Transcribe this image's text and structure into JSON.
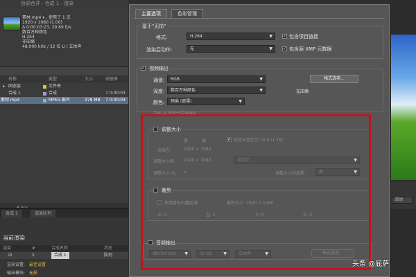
{
  "background": {
    "window_title": "协调合并 · 合成 1 · 渲染",
    "project_info": [
      "素材.mp4 ▾ , 使用了 1 次",
      "1920 x 1080 (1.00)",
      "Δ 0:00:03:23, 29.89 fps",
      "数百万种颜色",
      "H.264",
      "非压缩",
      "48.000 kHz / 32 位 U / 立体声"
    ],
    "columns": [
      "名称",
      "类型",
      "大小",
      "帧速率"
    ],
    "files": [
      {
        "name": "固态层",
        "type": "文件夹",
        "size": "",
        "fps": ""
      },
      {
        "name": "合成 1",
        "type": "合成",
        "size": "",
        "fps": "7 0:00:03"
      },
      {
        "name": "素材.mp4",
        "type": "MPEG 影片",
        "size": "378 MB",
        "fps": "7 0:00:03"
      }
    ],
    "status_bpc": "8 bpc",
    "queue_tabs": [
      "合成 1",
      "渲染队列"
    ],
    "queue_title": "当前渲染",
    "queue_columns": [
      "渲染",
      "#",
      "合成名称",
      "状态"
    ],
    "queue_row": {
      "num": "1",
      "name": "合成 1",
      "status": "队列"
    },
    "render_settings_label": "渲染设置:",
    "render_settings_value": "最佳设置",
    "output_module_label": "输出模块:",
    "output_module_value": "无损",
    "right_dropdown": "活动"
  },
  "dialog": {
    "tabs": [
      "主要选项",
      "色彩管理"
    ],
    "based_on": "基于\"无损\"",
    "format_label": "格式:",
    "format_value": "H.264",
    "post_render_label": "渲染后动作:",
    "post_render_value": "无",
    "include_project_link": "包含项目链接",
    "include_xmp": "包含源 XMP 元数据",
    "video_output": "视频输出",
    "channels_label": "通道:",
    "channels_value": "RGB",
    "depth_label": "深度:",
    "depth_value": "数百万种颜色",
    "color_label": "颜色:",
    "color_value": "预乘 (遮罩)",
    "format_options_btn": "格式选项...",
    "no_compression": "无压缩",
    "hidden_row": "开始 #  使用合成帧编号",
    "resize": {
      "title": "调整大小",
      "width_label": "宽",
      "height_label": "高",
      "lock_aspect": "锁定长宽比为 16:9 (1.78)",
      "render_at_label": "渲染在:",
      "render_at_value": "1920 × 1080",
      "resize_to_label": "调整大小到:",
      "resize_to_value": "1920 × 1080",
      "custom": "自定义",
      "percent_label": "调整大小 %:",
      "percent_value": "×",
      "quality_label": "调整大小后品质:",
      "quality_value": "高"
    },
    "crop": {
      "title": "裁剪",
      "use_roi": "使用目标兴趣区域",
      "final_size": "最终大小: 1920 × 1080",
      "top": "上: 0",
      "left": "左: 0",
      "bottom": "下: 0",
      "right": "右: 0"
    },
    "audio": {
      "title": "音频输出",
      "rate": "48.000 kHz",
      "bit": "32 bit",
      "channel": "立体声",
      "options_btn": "格式选项..."
    }
  },
  "watermark": "头条 @屁萨",
  "colors": {
    "highlight_box": "#c8121a",
    "selection": "#5b6f88"
  }
}
